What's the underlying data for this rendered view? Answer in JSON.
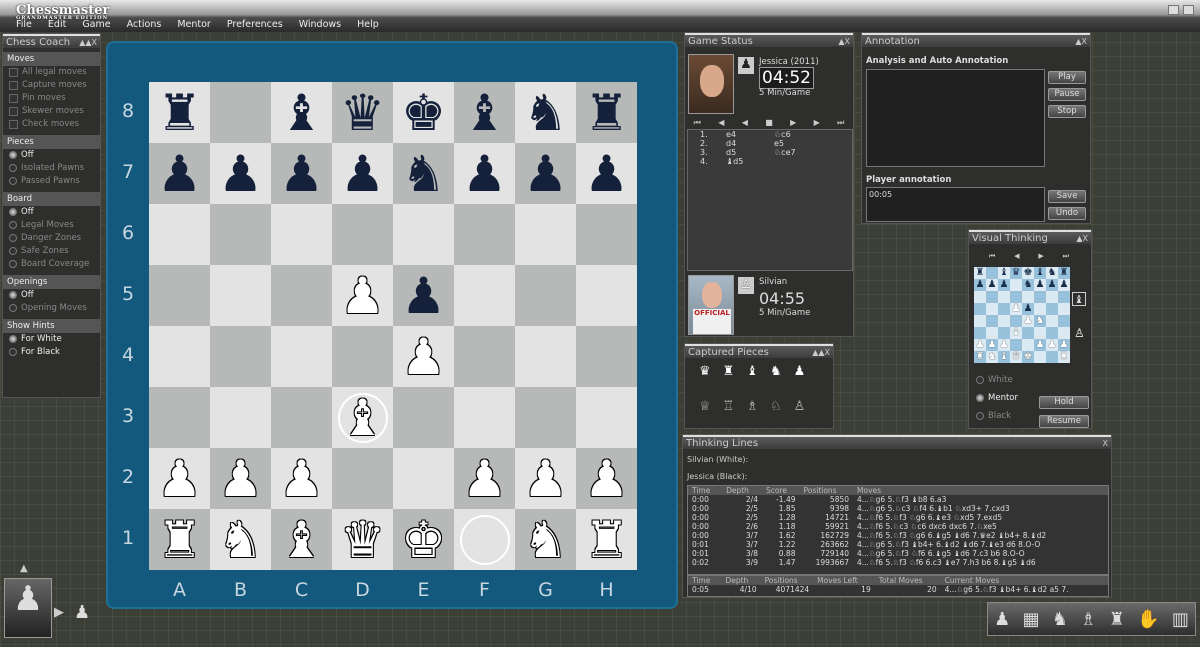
{
  "app": {
    "brand": "Chessmaster",
    "brand_sub": "GRANDMASTER EDITION"
  },
  "menu": [
    "File",
    "Edit",
    "Game",
    "Actions",
    "Mentor",
    "Preferences",
    "Windows",
    "Help"
  ],
  "coach": {
    "title": "Chess Coach",
    "sections": [
      {
        "label": "Moves",
        "items": [
          {
            "t": "All legal moves",
            "type": "cb",
            "on": false
          },
          {
            "t": "Capture moves",
            "type": "cb",
            "on": false
          },
          {
            "t": "Pin moves",
            "type": "cb",
            "on": false
          },
          {
            "t": "Skewer moves",
            "type": "cb",
            "on": false
          },
          {
            "t": "Check moves",
            "type": "cb",
            "on": false
          }
        ]
      },
      {
        "label": "Pieces",
        "items": [
          {
            "t": "Off",
            "type": "rb",
            "on": true
          },
          {
            "t": "Isolated Pawns",
            "type": "rb",
            "on": false
          },
          {
            "t": "Passed Pawns",
            "type": "rb",
            "on": false
          }
        ]
      },
      {
        "label": "Board",
        "items": [
          {
            "t": "Off",
            "type": "rb",
            "on": true
          },
          {
            "t": "Legal Moves",
            "type": "rb",
            "on": false
          },
          {
            "t": "Danger Zones",
            "type": "rb",
            "on": false
          },
          {
            "t": "Safe Zones",
            "type": "rb",
            "on": false
          },
          {
            "t": "Board Coverage",
            "type": "rb",
            "on": false
          }
        ]
      },
      {
        "label": "Openings",
        "items": [
          {
            "t": "Off",
            "type": "rb",
            "on": true
          },
          {
            "t": "Opening Moves",
            "type": "rb",
            "on": false
          }
        ]
      },
      {
        "label": "Show Hints",
        "items": [
          {
            "t": "For White",
            "type": "rb",
            "on": true
          },
          {
            "t": "For Black",
            "type": "rb",
            "on": false
          }
        ]
      }
    ]
  },
  "board": {
    "ranks": [
      "8",
      "7",
      "6",
      "5",
      "4",
      "3",
      "2",
      "1"
    ],
    "files": [
      "A",
      "B",
      "C",
      "D",
      "E",
      "F",
      "G",
      "H"
    ],
    "rows": [
      [
        "bR",
        "",
        "bB",
        "bQ",
        "bK",
        "bB",
        "bN",
        "bR"
      ],
      [
        "bP",
        "bP",
        "bP",
        "bP",
        "bN",
        "bP",
        "bP",
        "bP"
      ],
      [
        "",
        "",
        "",
        "",
        "",
        "",
        "",
        ""
      ],
      [
        "",
        "",
        "",
        "wP",
        "bP",
        "",
        "",
        ""
      ],
      [
        "",
        "",
        "",
        "",
        "wP",
        "",
        "",
        ""
      ],
      [
        "",
        "",
        "",
        "wB*",
        "",
        "",
        "",
        ""
      ],
      [
        "wP",
        "wP",
        "wP",
        "",
        "",
        "wP",
        "wP",
        "wP"
      ],
      [
        "wR",
        "wN",
        "wB",
        "wQ",
        "wK",
        "o",
        "wN",
        "wR"
      ]
    ]
  },
  "status": {
    "title": "Game Status",
    "black": {
      "name": "Jessica (2011)",
      "clock": "04:52",
      "mode": "5 Min/Game"
    },
    "white": {
      "name": "Silvian",
      "clock": "04:55",
      "mode": "5 Min/Game"
    },
    "moves": [
      [
        "1.",
        "e4",
        "♘c6"
      ],
      [
        "2.",
        "d4",
        "e5"
      ],
      [
        "3.",
        "d5",
        "♘ce7"
      ],
      [
        "4.",
        "♝d5",
        ""
      ]
    ]
  },
  "annotation": {
    "title": "Annotation",
    "analysis_label": "Analysis and Auto Annotation",
    "play": "Play",
    "pause": "Pause",
    "stop": "Stop",
    "player_label": "Player annotation",
    "player_text": "00:05",
    "save": "Save",
    "undo": "Undo"
  },
  "visual": {
    "title": "Visual Thinking",
    "opts": [
      "White",
      "Mentor",
      "Black"
    ],
    "hold": "Hold",
    "resume": "Resume"
  },
  "captured": {
    "title": "Captured Pieces",
    "top": [
      "♛",
      "♜",
      "♝",
      "♞",
      "♟"
    ],
    "bottom": [
      "♕",
      "♖",
      "♗",
      "♘",
      "♙"
    ]
  },
  "thinking": {
    "title": "Thinking Lines",
    "white_label": "Silvian (White):",
    "black_label": "Jessica (Black):",
    "headers": [
      "Time",
      "Depth",
      "Score",
      "Positions",
      "Moves"
    ],
    "rows": [
      [
        "0:00",
        "2/4",
        "-1.49",
        "5850",
        "4...♘g6 5.♘f3 ♝b8 6.a3"
      ],
      [
        "0:00",
        "2/5",
        "1.85",
        "9398",
        "4...♘g6 5.♘c3 ♘f4 6.♝b1 ♘xd3+ 7.cxd3"
      ],
      [
        "0:00",
        "2/5",
        "1.28",
        "14721",
        "4...♘f6 5.♘f3 ♘g6 6.♝e3 ♘xd5 7.exd5"
      ],
      [
        "0:00",
        "2/6",
        "1.18",
        "59921",
        "4...♘f6 5.♘c3 ♘c6 dxc6 dxc6 7.♘xe5"
      ],
      [
        "0:00",
        "3/7",
        "1.62",
        "162729",
        "4...♘f6 5.♘f3 ♘g6 6.♝g5 ♝d6 7.♛e2 ♝b4+ 8.♝d2"
      ],
      [
        "0:01",
        "3/7",
        "1.22",
        "263662",
        "4...♘g6 5.♘f3 ♝b4+ 6.♝d2 ♝d6 7.♝e3 d6 8.O-O"
      ],
      [
        "0:01",
        "3/8",
        "0.88",
        "729140",
        "4...♘g6 5.♘f3 ♘f6 6.♝g5 ♝d6 7.c3 b6 8.O-O"
      ],
      [
        "0:02",
        "3/9",
        "1.47",
        "1993667",
        "4...♘f6 5.♘f3 ♘f6 6.c3 ♝e7 7.h3 b6 8.♝g5 ♝d6"
      ]
    ],
    "footer_headers": [
      "Time",
      "Depth",
      "Positions",
      "Moves Left",
      "Total Moves",
      "Current Moves"
    ],
    "footer": [
      "0:05",
      "4/10",
      "4071424",
      "19",
      "20",
      "4...♘g6 5.♘f3 ♝b4+ 6.♝d2 a5 7."
    ]
  },
  "colors": {
    "board_frame": "#13597e",
    "light_sq": "#e3e3e3",
    "dark_sq": "#b7b9b9",
    "bg": "#3c3f35"
  }
}
